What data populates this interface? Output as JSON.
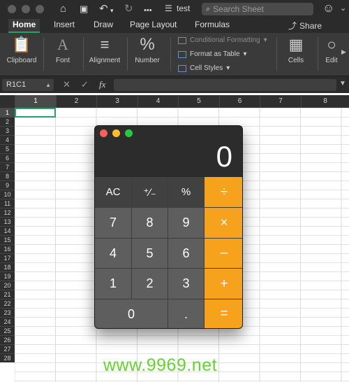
{
  "titlebar": {
    "title": "test",
    "search_placeholder": "Search Sheet"
  },
  "tabs": [
    {
      "label": "Home",
      "active": true
    },
    {
      "label": "Insert"
    },
    {
      "label": "Draw"
    },
    {
      "label": "Page Layout"
    },
    {
      "label": "Formulas"
    }
  ],
  "share_label": "Share",
  "ribbon": {
    "clipboard": "Clipboard",
    "font": "Font",
    "alignment": "Alignment",
    "number": "Number",
    "number_symbol": "%",
    "conditional_formatting": "Conditional Formatting",
    "format_as_table": "Format as Table",
    "cell_styles": "Cell Styles",
    "cells": "Cells",
    "editing": "Edit"
  },
  "formula_bar": {
    "name_box": "R1C1",
    "fx": "fx",
    "value": ""
  },
  "columns": [
    "1",
    "2",
    "3",
    "4",
    "5",
    "6",
    "7",
    "8"
  ],
  "rows": [
    "1",
    "2",
    "3",
    "4",
    "5",
    "6",
    "7",
    "8",
    "9",
    "10",
    "11",
    "12",
    "13",
    "14",
    "15",
    "16",
    "17",
    "18",
    "19",
    "20",
    "21",
    "22",
    "23",
    "24",
    "25",
    "26",
    "27",
    "28"
  ],
  "calculator": {
    "display": "0",
    "keys": {
      "ac": "AC",
      "plus_minus": "⁺∕₋",
      "percent": "%",
      "divide": "÷",
      "seven": "7",
      "eight": "8",
      "nine": "9",
      "multiply": "×",
      "four": "4",
      "five": "5",
      "six": "6",
      "minus": "–",
      "one": "1",
      "two": "2",
      "three": "3",
      "plus": "+",
      "zero": "0",
      "decimal": ".",
      "equals": "="
    }
  },
  "watermark": "www.9969.net",
  "colors": {
    "accent": "#21a366",
    "calc_operator": "#f6a21d",
    "ribbon_bg": "#3a3a3a"
  }
}
